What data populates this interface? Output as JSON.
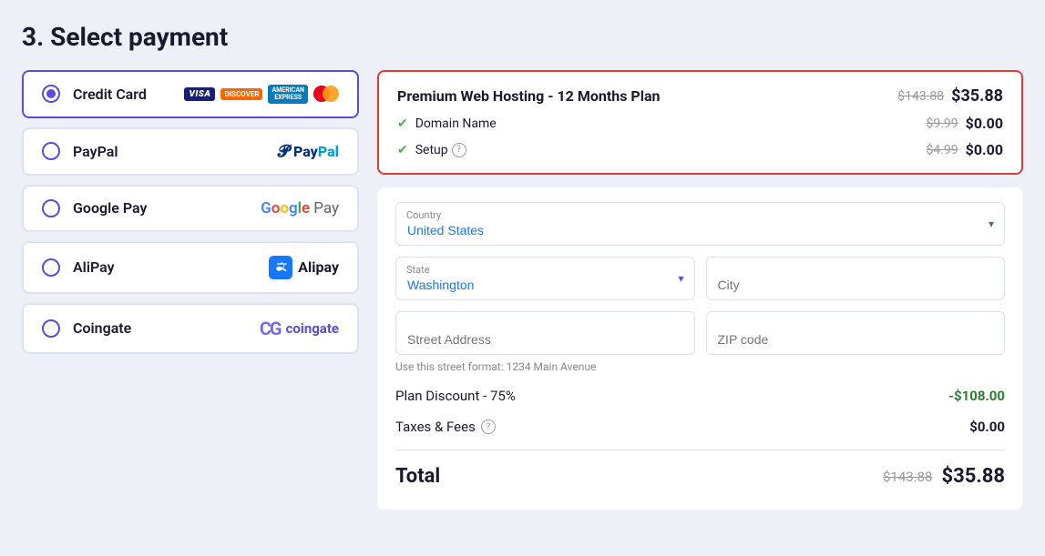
{
  "page": {
    "title": "3. Select payment"
  },
  "payment_methods": [
    {
      "id": "credit-card",
      "label": "Credit Card",
      "selected": true,
      "type": "credit-card"
    },
    {
      "id": "paypal",
      "label": "PayPal",
      "selected": false,
      "type": "paypal"
    },
    {
      "id": "google-pay",
      "label": "Google Pay",
      "selected": false,
      "type": "google-pay"
    },
    {
      "id": "alipay",
      "label": "AliPay",
      "selected": false,
      "type": "alipay"
    },
    {
      "id": "coingate",
      "label": "Coingate",
      "selected": false,
      "type": "coingate"
    }
  ],
  "order_summary": {
    "plan_name": "Premium Web Hosting - 12 Months Plan",
    "plan_old_price": "$143.88",
    "plan_new_price": "$35.88",
    "items": [
      {
        "name": "Domain Name",
        "has_help": false,
        "old_price": "$9.99",
        "new_price": "$0.00"
      },
      {
        "name": "Setup",
        "has_help": true,
        "old_price": "$4.99",
        "new_price": "$0.00"
      }
    ]
  },
  "address_form": {
    "country_label": "Country",
    "country_value": "United States",
    "state_label": "State",
    "state_value": "Washington",
    "city_placeholder": "City",
    "street_placeholder": "Street Address",
    "street_hint": "Use this street format: 1234 Main Avenue",
    "zip_placeholder": "ZIP code"
  },
  "totals": {
    "discount_label": "Plan Discount - 75%",
    "discount_value": "-$108.00",
    "taxes_label": "Taxes & Fees",
    "taxes_value": "$0.00",
    "total_label": "Total",
    "total_old_price": "$143.88",
    "total_new_price": "$35.88"
  }
}
